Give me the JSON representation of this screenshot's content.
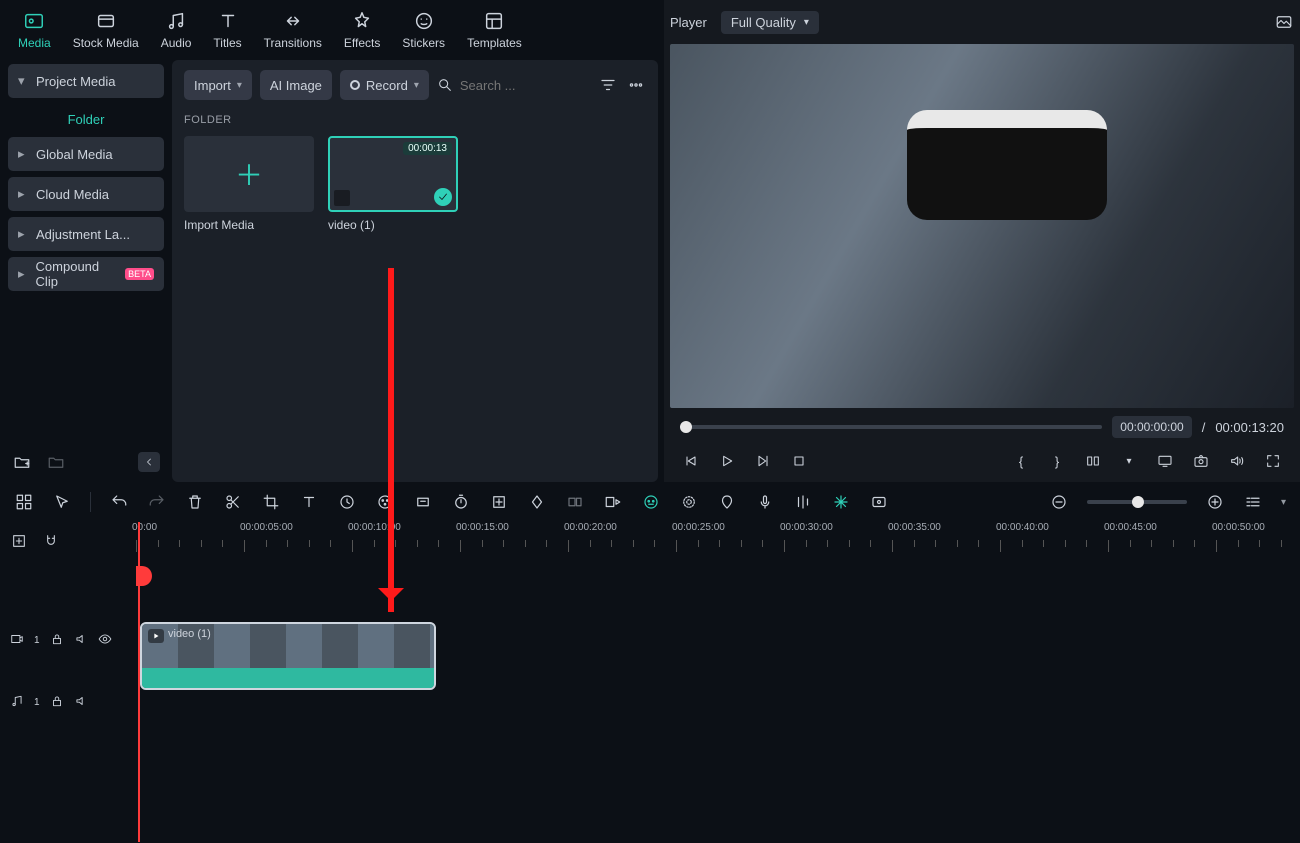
{
  "tabs": {
    "media": "Media",
    "stock": "Stock Media",
    "audio": "Audio",
    "titles": "Titles",
    "transitions": "Transitions",
    "effects": "Effects",
    "stickers": "Stickers",
    "templates": "Templates"
  },
  "sidebar": {
    "project": "Project Media",
    "folder": "Folder",
    "global": "Global Media",
    "cloud": "Cloud Media",
    "adjust": "Adjustment La...",
    "compound": "Compound Clip",
    "beta": "BETA"
  },
  "toolbar": {
    "import": "Import",
    "aiimage": "AI Image",
    "record": "Record",
    "search_placeholder": "Search ..."
  },
  "folder_heading": "FOLDER",
  "import_card": "Import Media",
  "clip": {
    "name": "video (1)",
    "duration": "00:00:13",
    "timeline_label": "video (1)"
  },
  "player": {
    "title": "Player",
    "quality": "Full Quality",
    "current": "00:00:00:00",
    "sep": "/",
    "total": "00:00:13:20"
  },
  "ruler": {
    "labels": [
      "00:00",
      "00:00:05:00",
      "00:00:10:00",
      "00:00:15:00",
      "00:00:20:00",
      "00:00:25:00",
      "00:00:30:00",
      "00:00:35:00",
      "00:00:40:00",
      "00:00:45:00",
      "00:00:50:00"
    ]
  },
  "tracks": {
    "video_num": "1",
    "audio_num": "1"
  }
}
